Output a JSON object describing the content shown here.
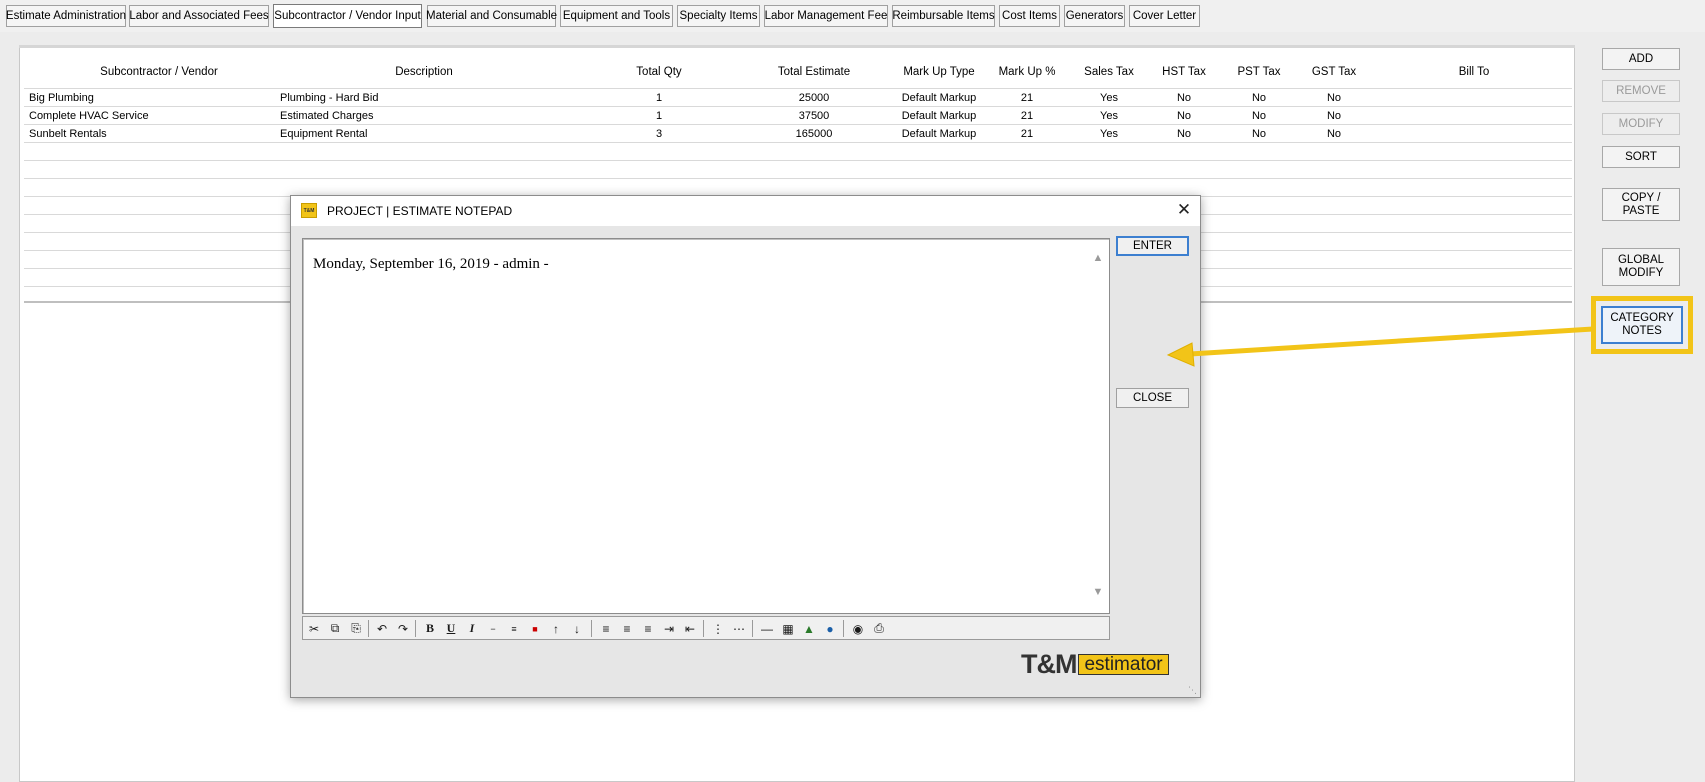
{
  "tabs": [
    {
      "label": "Estimate Administration",
      "active": false
    },
    {
      "label": "Labor and Associated Fees",
      "active": false
    },
    {
      "label": "Subcontractor / Vendor Input",
      "active": true
    },
    {
      "label": "Material and Consumable",
      "active": false
    },
    {
      "label": "Equipment and Tools",
      "active": false
    },
    {
      "label": "Specialty Items",
      "active": false
    },
    {
      "label": "Labor Management Fee",
      "active": false
    },
    {
      "label": "Reimbursable Items",
      "active": false
    },
    {
      "label": "Cost Items",
      "active": false
    },
    {
      "label": "Generators",
      "active": false
    },
    {
      "label": "Cover Letter",
      "active": false
    }
  ],
  "grid": {
    "columns": [
      "Subcontractor / Vendor",
      "Description",
      "Total Qty",
      "Total Estimate",
      "Mark Up Type",
      "Mark Up %",
      "Sales Tax",
      "HST Tax",
      "PST Tax",
      "GST Tax",
      "Bill To"
    ],
    "rows": [
      [
        "Big Plumbing",
        "Plumbing - Hard Bid",
        "1",
        "25000",
        "Default Markup",
        "21",
        "Yes",
        "No",
        "No",
        "No",
        ""
      ],
      [
        "Complete HVAC Service",
        "Estimated Charges",
        "1",
        "37500",
        "Default Markup",
        "21",
        "Yes",
        "No",
        "No",
        "No",
        ""
      ],
      [
        "Sunbelt Rentals",
        "Equipment Rental",
        "3",
        "165000",
        "Default Markup",
        "21",
        "Yes",
        "No",
        "No",
        "No",
        ""
      ]
    ]
  },
  "side_buttons": {
    "add": "ADD",
    "remove": "REMOVE",
    "modify": "MODIFY",
    "sort": "SORT",
    "copy_paste": "COPY / PASTE",
    "global_modify": "GLOBAL MODIFY",
    "category_notes": "CATEGORY NOTES"
  },
  "dialog": {
    "title": "PROJECT | ESTIMATE NOTEPAD",
    "badge": "T&M",
    "close_glyph": "✕",
    "note_text": "Monday, September 16, 2019 - admin -",
    "enter_label": "ENTER",
    "close_label": "CLOSE",
    "brand_tm": "T&M",
    "brand_estimator": "estimator"
  },
  "toolbar_icons": [
    "cut-icon",
    "copy-icon",
    "paste-icon",
    "undo-icon",
    "redo-icon",
    "bold-icon",
    "underline-icon",
    "italic-icon",
    "strikethrough-icon",
    "double-strikethrough-icon",
    "font-color-icon",
    "increase-font-icon",
    "decrease-font-icon",
    "align-left-icon",
    "align-center-icon",
    "align-right-icon",
    "indent-icon",
    "outdent-icon",
    "bullet-list-icon",
    "numbered-list-icon",
    "horizontal-rule-icon",
    "table-icon",
    "image-icon",
    "hyperlink-icon",
    "find-icon",
    "print-icon"
  ],
  "colors": {
    "accent_yellow": "#f2c418",
    "focus_blue": "#3c7fd0"
  }
}
